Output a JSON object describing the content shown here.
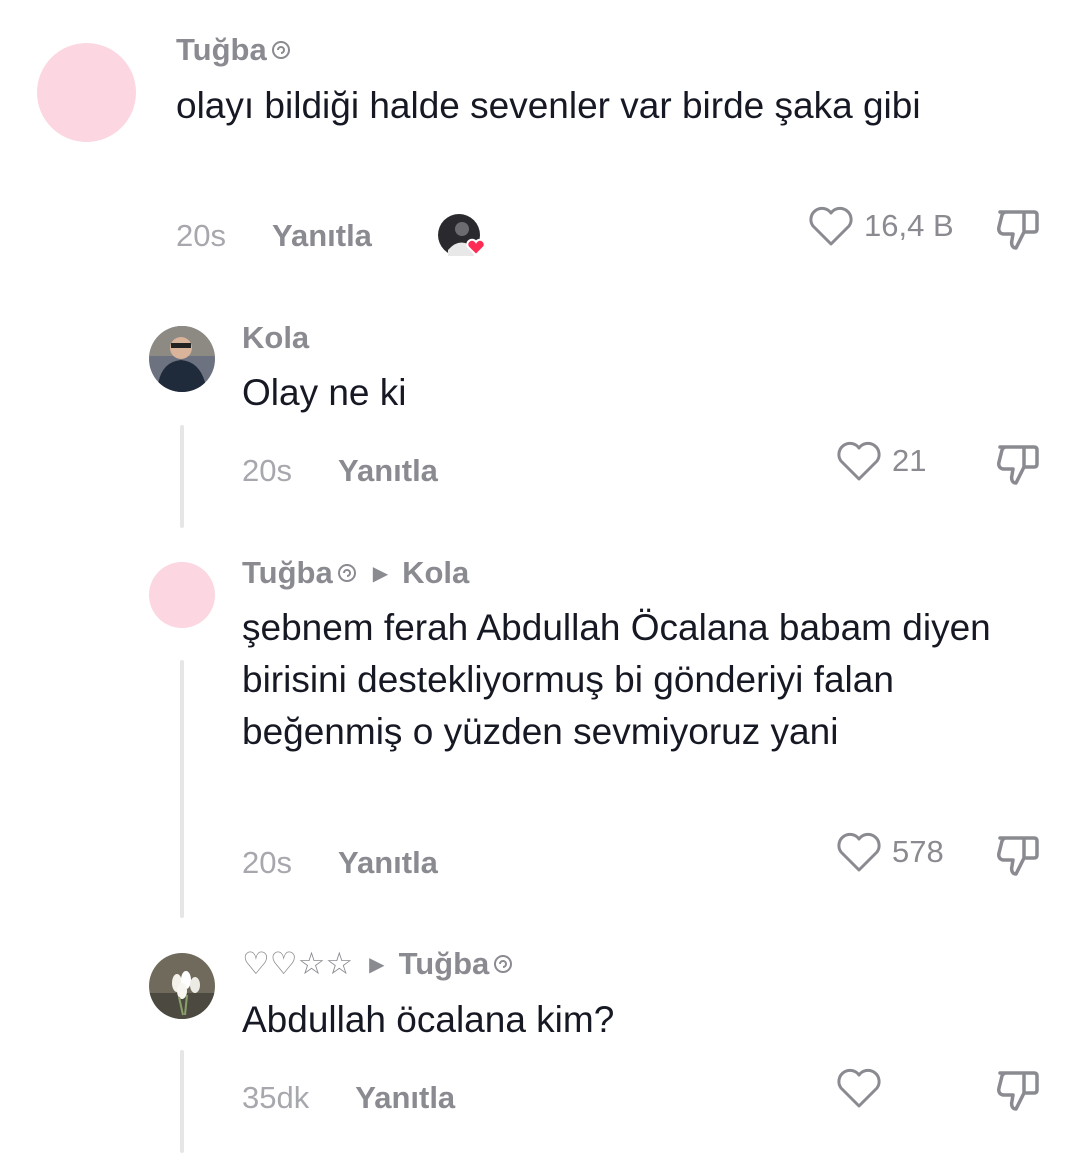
{
  "comments": [
    {
      "user": "Tuğba",
      "reply_to": "",
      "text": "olayı bildiği halde sevenler var birde şaka gibi",
      "time": "20s",
      "reply_label": "Yanıtla",
      "likes": "16,4 B"
    },
    {
      "user": "Kola",
      "reply_to": "",
      "text": "Olay ne ki",
      "time": "20s",
      "reply_label": "Yanıtla",
      "likes": "21"
    },
    {
      "user": "Tuğba",
      "reply_to": "Kola",
      "text": "şebnem ferah Abdullah Öcalana babam diyen birisini destekliyormuş bi gönderiyi falan beğenmiş o yüzden sevmiyoruz yani",
      "time": "20s",
      "reply_label": "Yanıtla",
      "likes": "578"
    },
    {
      "user": "♡♡☆☆",
      "reply_to": "Tuğba",
      "text": "Abdullah öcalana kim?",
      "time": "35dk",
      "reply_label": "Yanıtla",
      "likes": ""
    }
  ],
  "icons": {
    "like": "heart-outline-icon",
    "dislike": "thumbs-down-outline-icon",
    "creator_liked": "heart-badge-icon",
    "reply_arrow": "triangle-right-icon",
    "user_badge": "swirl-badge-icon"
  },
  "colors": {
    "pink_avatar": "#fcd6e0",
    "muted_text": "#8a8b91",
    "heart_badge": "#fe2c55"
  }
}
